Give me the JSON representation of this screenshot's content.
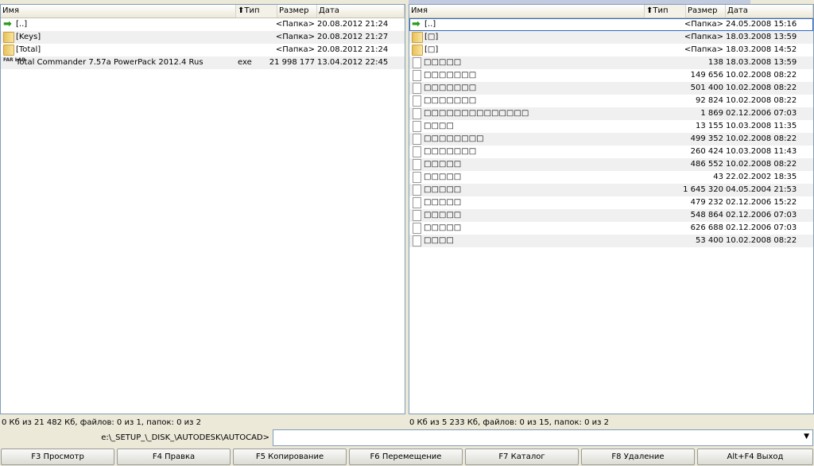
{
  "left_panel": {
    "columns": [
      "Имя",
      "Тип",
      "Размер",
      "Дата"
    ],
    "sort_icon": "arrow-up-icon",
    "rows": [
      {
        "icon": "up-arrow-icon",
        "name": "[..]",
        "ext": "",
        "size": "<Папка>",
        "date": "20.08.2012 21:24"
      },
      {
        "icon": "folder-icon",
        "name": "[Keys]",
        "ext": "",
        "size": "<Папка>",
        "date": "20.08.2012 21:27"
      },
      {
        "icon": "folder-icon",
        "name": "[Total]",
        "ext": "",
        "size": "<Папка>",
        "date": "20.08.2012 21:24"
      },
      {
        "icon": "exe-icon",
        "name": "Total Commander 7.57a PowerPack 2012.4 Rus",
        "ext": "exe",
        "size": "21 998 177",
        "date": "13.04.2012 22:45"
      }
    ],
    "status": "0 Кб из 21 482 Кб, файлов: 0 из 1, папок: 0 из 2"
  },
  "right_panel": {
    "columns": [
      "Имя",
      "Тип",
      "Размер",
      "Дата"
    ],
    "rows": [
      {
        "icon": "up-arrow-icon",
        "name": "[..]",
        "size": "<Папка>",
        "date": "24.05.2008 15:16"
      },
      {
        "icon": "folder-icon",
        "name": "[□]",
        "size": "<Папка>",
        "date": "18.03.2008 13:59"
      },
      {
        "icon": "folder-icon",
        "name": "[□]",
        "size": "<Папка>",
        "date": "18.03.2008 14:52"
      },
      {
        "icon": "file-icon",
        "name": "□□□□□",
        "size": "138",
        "date": "18.03.2008 13:59"
      },
      {
        "icon": "file-icon",
        "name": "□□□□□□□",
        "size": "149 656",
        "date": "10.02.2008 08:22"
      },
      {
        "icon": "file-icon",
        "name": "□□□□□□□",
        "size": "501 400",
        "date": "10.02.2008 08:22"
      },
      {
        "icon": "file-icon",
        "name": "□□□□□□□",
        "size": "92 824",
        "date": "10.02.2008 08:22"
      },
      {
        "icon": "file-icon",
        "name": "□□□□□□□□□□□□□□",
        "size": "1 869",
        "date": "02.12.2006 07:03"
      },
      {
        "icon": "file-icon",
        "name": "□□□□",
        "size": "13 155",
        "date": "10.03.2008 11:35"
      },
      {
        "icon": "file-icon",
        "name": "□□□□□□□□",
        "size": "499 352",
        "date": "10.02.2008 08:22"
      },
      {
        "icon": "file-icon",
        "name": "□□□□□□□",
        "size": "260 424",
        "date": "10.03.2008 11:43"
      },
      {
        "icon": "file-icon",
        "name": "□□□□□",
        "size": "486 552",
        "date": "10.02.2008 08:22"
      },
      {
        "icon": "file-icon",
        "name": "□□□□□",
        "size": "43",
        "date": "22.02.2002 18:35"
      },
      {
        "icon": "file-icon",
        "name": "□□□□□",
        "size": "1 645 320",
        "date": "04.05.2004 21:53"
      },
      {
        "icon": "file-icon",
        "name": "□□□□□",
        "size": "479 232",
        "date": "02.12.2006 15:22"
      },
      {
        "icon": "file-icon",
        "name": "□□□□□",
        "size": "548 864",
        "date": "02.12.2006 07:03"
      },
      {
        "icon": "file-icon",
        "name": "□□□□□",
        "size": "626 688",
        "date": "02.12.2006 07:03"
      },
      {
        "icon": "file-icon",
        "name": "□□□□",
        "size": "53 400",
        "date": "10.02.2008 08:22"
      }
    ],
    "status": "0 Кб из 5 233 Кб, файлов: 0 из 15, папок: 0 из 2"
  },
  "command_line": {
    "path": "e:\\_SETUP_\\_DISK_\\AUTODESK\\AUTOCAD>",
    "value": "",
    "dropdown_icon": "▼"
  },
  "function_keys": [
    "F3 Просмотр",
    "F4 Правка",
    "F5 Копирование",
    "F6 Перемещение",
    "F7 Каталог",
    "F8 Удаление",
    "Alt+F4 Выход"
  ]
}
